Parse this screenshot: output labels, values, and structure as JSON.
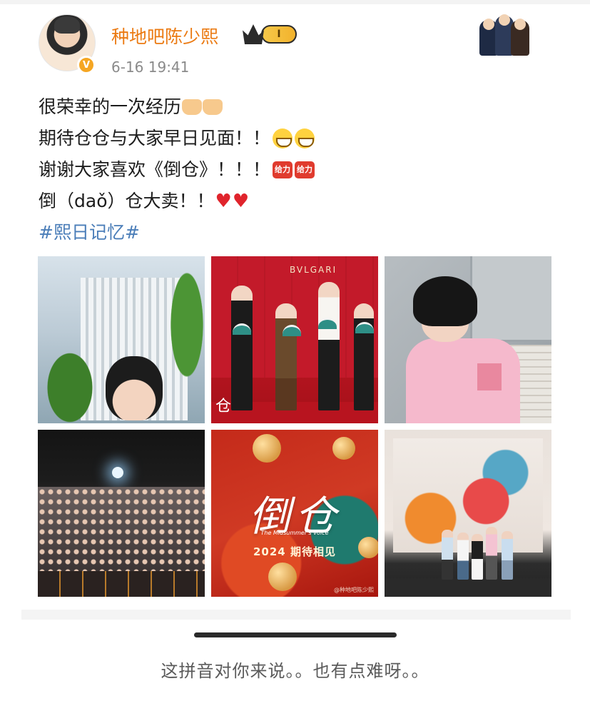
{
  "post": {
    "username": "种地吧陈少熙",
    "vip_level": "I",
    "timestamp": "6-16 19:41",
    "verified_badge": "V",
    "icons": {
      "avatar": "husky-avatar-icon",
      "vip": "crown-icon",
      "verified": "verified-v-icon",
      "sticker": "anime-characters-icon"
    },
    "content": {
      "line1": "很荣幸的一次经历",
      "line2": "期待仓仓与大家早日见面！！",
      "line3": "谢谢大家喜欢《倒仓》！！！",
      "line3_emoji_text": "给力",
      "line4": "倒（daǒ）仓大卖！！",
      "hashtag": "#熙日记忆#"
    },
    "images": {
      "tile2_brand": "BVLGARI",
      "tile2_text": "仓",
      "tile5_title": "倒仓",
      "tile5_subtitle": "The Midsummer's Voice",
      "tile5_year": "2024 期待相见",
      "tile5_watermark": "@种地吧陈少熙"
    }
  },
  "colors": {
    "username": "#eb7a12",
    "hashtag": "#4a7db8",
    "timestamp": "#8a8a8a",
    "heart": "#e0242c"
  },
  "footer": {
    "comment": "这拼音对你来说。。也有点难呀。。"
  }
}
